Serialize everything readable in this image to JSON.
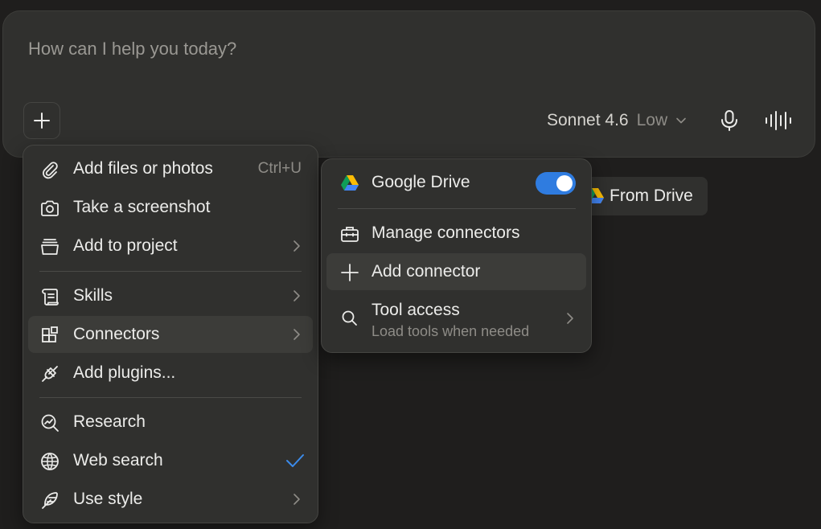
{
  "composer": {
    "placeholder": "How can I help you today?",
    "model_name": "Sonnet 4.6",
    "effort": "Low",
    "plus_icon": "plus-icon",
    "mic_icon": "microphone-icon",
    "voice_icon": "voice-waveform-icon"
  },
  "drive_chip": {
    "label": "From Drive",
    "icon": "google-drive-icon"
  },
  "menu": {
    "items": [
      {
        "label": "Add files or photos",
        "shortcut": "Ctrl+U",
        "icon": "paperclip-icon"
      },
      {
        "label": "Take a screenshot",
        "icon": "camera-icon"
      },
      {
        "label": "Add to project",
        "icon": "project-box-icon"
      },
      {
        "label": "Skills",
        "icon": "scroll-icon"
      },
      {
        "label": "Connectors",
        "icon": "connectors-grid-icon"
      },
      {
        "label": "Add plugins...",
        "icon": "plug-icon"
      },
      {
        "label": "Research",
        "icon": "research-icon"
      },
      {
        "label": "Web search",
        "icon": "globe-icon",
        "checked": true
      },
      {
        "label": "Use style",
        "icon": "feather-icon"
      }
    ]
  },
  "submenu": {
    "google_drive": {
      "label": "Google Drive",
      "enabled": true,
      "icon": "google-drive-icon"
    },
    "manage": {
      "label": "Manage connectors",
      "icon": "toolbox-icon"
    },
    "add": {
      "label": "Add connector",
      "icon": "plus-icon"
    },
    "tool_access": {
      "label": "Tool access",
      "sublabel": "Load tools when needed",
      "icon": "search-icon"
    }
  },
  "colors": {
    "background": "#1f1e1d",
    "surface": "#30302e",
    "accent": "#2f7ce0",
    "check": "#3b8beb"
  }
}
